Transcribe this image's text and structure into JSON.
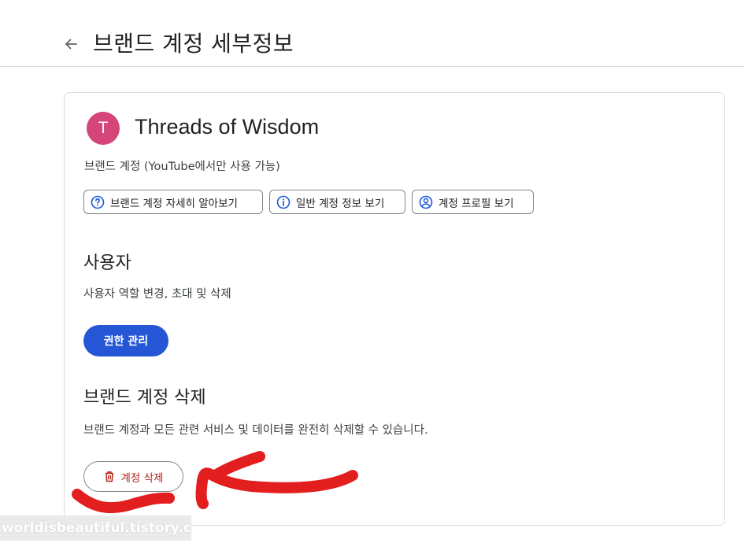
{
  "header": {
    "title": "브랜드 계정 세부정보",
    "back_icon": "arrow-back-icon"
  },
  "account": {
    "avatar_letter": "T",
    "avatar_color": "#d6457a",
    "name": "Threads of Wisdom",
    "type_text": "브랜드 계정 (YouTube에서만 사용 가능)"
  },
  "chips": [
    {
      "label": "브랜드 계정 자세히 알아보기",
      "icon": "help-circle-icon"
    },
    {
      "label": "일반 계정 정보 보기",
      "icon": "info-icon"
    },
    {
      "label": "계정 프로필 보기",
      "icon": "account-circle-icon"
    }
  ],
  "users": {
    "title": "사용자",
    "description": "사용자 역할 변경, 초대 및 삭제",
    "button_label": "권한 관리"
  },
  "delete": {
    "title": "브랜드 계정 삭제",
    "description": "브랜드 계정과 모든 관련 서비스 및 데이터를 완전히 삭제할 수 있습니다.",
    "button_label": "계정 삭제",
    "button_icon": "trash-icon"
  },
  "watermark": {
    "text": "worldisbeautiful.tistory.com"
  },
  "colors": {
    "primary": "#2456d6",
    "danger": "#b3261e",
    "annotation": "#e31e1e"
  }
}
